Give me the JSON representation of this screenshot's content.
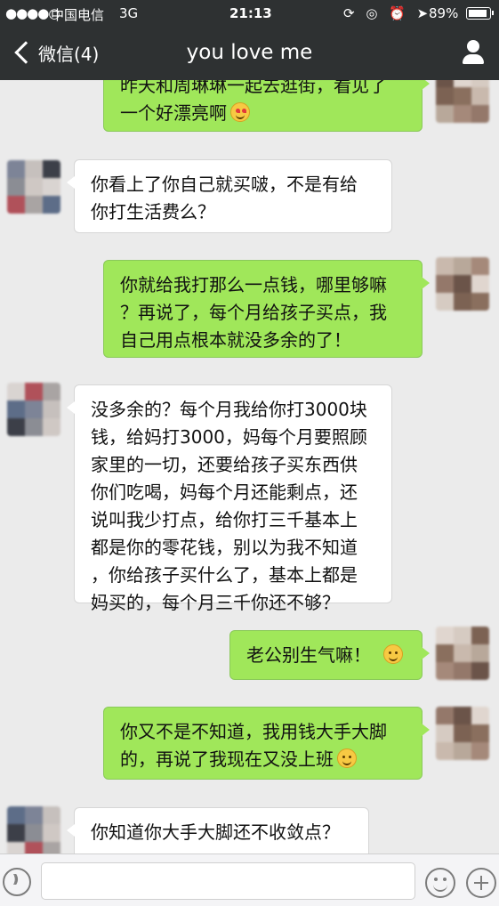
{
  "status_bar": {
    "signal": "●●●●○",
    "carrier": "中国电信",
    "network": "3G",
    "time": "21:13",
    "icons": "⟳ ◎ ⏰ ➤",
    "battery_percent": 89,
    "battery_text": "89%"
  },
  "nav": {
    "back_label": "微信(4)",
    "title": "you love me"
  },
  "messages": [
    {
      "side": "right",
      "text": "昨天和周琳琳一起去逛街，看见了\n一个好漂亮啊",
      "emoji": "heart-eyes-emoji"
    },
    {
      "side": "left",
      "text": "你看上了你自己就买啵，不是有给\n你打生活费么？"
    },
    {
      "side": "right",
      "text": "你就给我打那么一点钱，哪里够嘛\n？再说了，每个月给孩子买点，我\n自己用点根本就没多余的了！"
    },
    {
      "side": "left",
      "text": "没多余的？每个月我给你打3000块\n钱，给妈打3000，妈每个月要照顾\n家里的一切，还要给孩子买东西供\n你们吃喝，妈每个月还能剩点，还\n说叫我少打点，给你打三千基本上\n都是你的零花钱，别以为我不知道\n，你给孩子买什么了，基本上都是\n妈买的，每个月三千你还不够？"
    },
    {
      "side": "right",
      "text": "老公别生气嘛！",
      "emoji": "smile-emoji"
    },
    {
      "side": "right",
      "text": "你又不是不知道，我用钱大手大脚\n的，再说了我现在又没上班",
      "emoji": "smile-emoji"
    },
    {
      "side": "left",
      "text": "你知道你大手大脚还不收敛点？"
    }
  ],
  "input": {
    "placeholder": "",
    "value": ""
  },
  "colors": {
    "nav_bg": "#2e3132",
    "chat_bg": "#ebebeb",
    "bubble_right": "#a0e75a",
    "bubble_left": "#ffffff"
  }
}
